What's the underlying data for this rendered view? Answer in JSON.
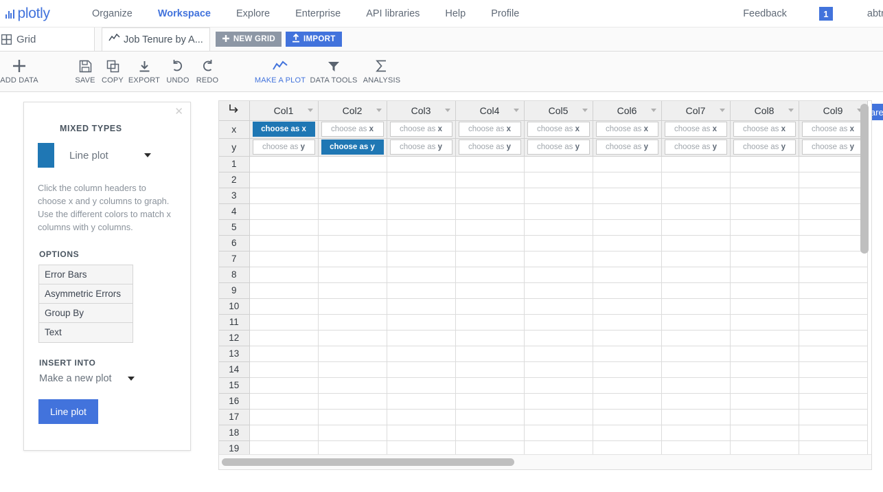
{
  "nav": {
    "brand": "plotly",
    "links": [
      {
        "label": "Organize",
        "active": false
      },
      {
        "label": "Workspace",
        "active": true
      },
      {
        "label": "Explore",
        "active": false
      },
      {
        "label": "Enterprise",
        "active": false
      },
      {
        "label": "API libraries",
        "active": false
      },
      {
        "label": "Help",
        "active": false
      },
      {
        "label": "Profile",
        "active": false
      }
    ],
    "feedback": "Feedback",
    "notification_count": "1",
    "username": "abtran",
    "accent_color": "#4273dc"
  },
  "tabbar": {
    "grid_tab_label": "Grid",
    "file_tab_label": "Job Tenure by A...",
    "new_grid_label": "NEW GRID",
    "import_label": "IMPORT"
  },
  "toolbar": {
    "items": [
      {
        "label": "ADD DATA",
        "icon": "plus-icon",
        "accent": false
      },
      {
        "label": "SAVE",
        "icon": "floppy-disk-icon",
        "accent": false
      },
      {
        "label": "COPY",
        "icon": "copy-icon",
        "accent": false
      },
      {
        "label": "EXPORT",
        "icon": "download-icon",
        "accent": false
      },
      {
        "label": "UNDO",
        "icon": "undo-arrow-icon",
        "accent": false
      },
      {
        "label": "REDO",
        "icon": "redo-arrow-icon",
        "accent": false
      },
      {
        "label": "MAKE A PLOT",
        "icon": "line-chart-icon",
        "accent": true
      },
      {
        "label": "DATA TOOLS",
        "icon": "funnel-icon",
        "accent": false
      },
      {
        "label": "ANALYSIS",
        "icon": "sigma-icon",
        "accent": false
      }
    ],
    "share_label": "Share"
  },
  "panel": {
    "title": "MIXED TYPES",
    "trace_color": "#1f77b4",
    "trace_type": "Line plot",
    "description": "Click the column headers to choose x and y columns to graph. Use the different colors to match x columns with y columns.",
    "options_label": "OPTIONS",
    "options": [
      "Error Bars",
      "Asymmetric Errors",
      "Group By",
      "Text"
    ],
    "insert_label": "INSERT INTO",
    "insert_value": "Make a new plot",
    "submit_label": "Line plot",
    "close_icon": "✕"
  },
  "grid": {
    "axis_labels": [
      "x",
      "y"
    ],
    "choose_x_text": "choose as ",
    "choose_x_bold": "x",
    "choose_y_text": "choose as ",
    "choose_y_bold": "y",
    "columns": [
      {
        "name": "Col1",
        "x_selected": true,
        "y_selected": false
      },
      {
        "name": "Col2",
        "x_selected": false,
        "y_selected": true
      },
      {
        "name": "Col3",
        "x_selected": false,
        "y_selected": false
      },
      {
        "name": "Col4",
        "x_selected": false,
        "y_selected": false
      },
      {
        "name": "Col5",
        "x_selected": false,
        "y_selected": false
      },
      {
        "name": "Col6",
        "x_selected": false,
        "y_selected": false
      },
      {
        "name": "Col7",
        "x_selected": false,
        "y_selected": false
      },
      {
        "name": "Col8",
        "x_selected": false,
        "y_selected": false
      },
      {
        "name": "Col9",
        "x_selected": false,
        "y_selected": false
      }
    ],
    "rows": [
      "1",
      "2",
      "3",
      "4",
      "5",
      "6",
      "7",
      "8",
      "9",
      "10",
      "11",
      "12",
      "13",
      "14",
      "15",
      "16",
      "17",
      "18",
      "19"
    ],
    "selected_color": "#1f77b4"
  }
}
